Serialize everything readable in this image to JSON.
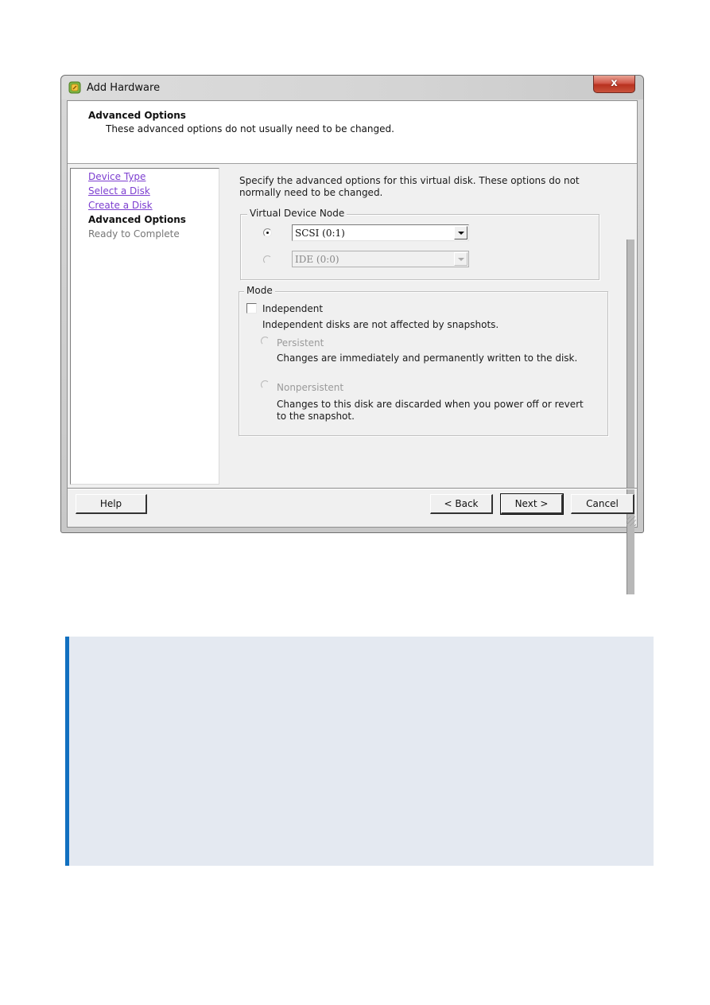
{
  "window": {
    "title": "Add Hardware",
    "close_label": "x"
  },
  "header": {
    "title": "Advanced Options",
    "subtitle": "These advanced options do not usually need to be changed."
  },
  "steps": [
    {
      "label": "Device Type",
      "state": "link"
    },
    {
      "label": "Select a Disk",
      "state": "link"
    },
    {
      "label": "Create a Disk",
      "state": "link"
    },
    {
      "label": "Advanced Options",
      "state": "current"
    },
    {
      "label": "Ready to Complete",
      "state": "future"
    }
  ],
  "main": {
    "description": "Specify the advanced options for this virtual disk. These options do not normally need to be changed.",
    "virtual_device_node": {
      "legend": "Virtual Device Node",
      "options": [
        {
          "value": "SCSI (0:1)",
          "selected": true,
          "enabled": true
        },
        {
          "value": "IDE (0:0)",
          "selected": false,
          "enabled": false
        }
      ]
    },
    "mode": {
      "legend": "Mode",
      "independent_label": "Independent",
      "independent_checked": false,
      "independent_desc": "Independent disks are not affected by snapshots.",
      "persistent_label": "Persistent",
      "persistent_desc": "Changes are immediately and permanently written to the disk.",
      "nonpersistent_label": "Nonpersistent",
      "nonpersistent_desc": "Changes to this disk are discarded when you power off or revert to the snapshot."
    }
  },
  "footer": {
    "help_label": "Help",
    "back_label": "< Back",
    "next_label": "Next >",
    "cancel_label": "Cancel"
  },
  "note_box": {
    "accent_color": "#1170c0",
    "background_color": "#e4e9f1"
  }
}
